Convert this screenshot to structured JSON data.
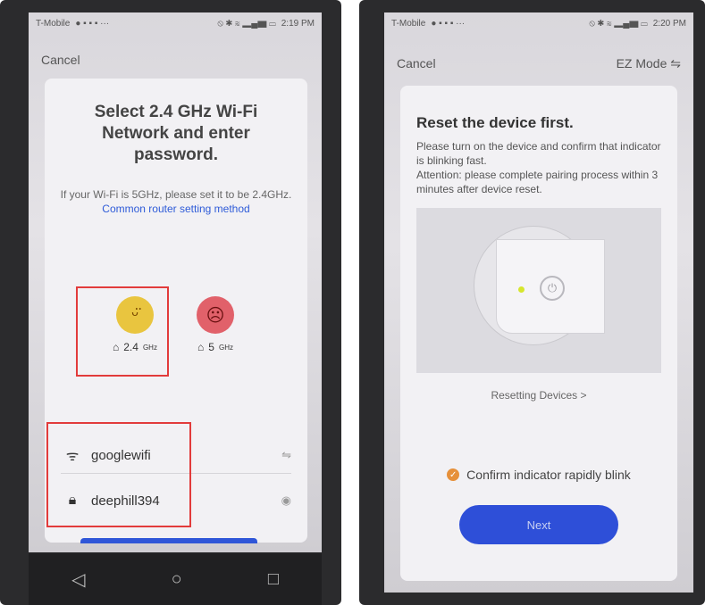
{
  "left": {
    "status": {
      "carrier": "T-Mobile",
      "time": "2:19 PM"
    },
    "cancel_label": "Cancel",
    "title": "Select 2.4 GHz Wi-Fi Network and enter password.",
    "description": "If your Wi-Fi is 5GHz, please set it to be 2.4GHz.",
    "link_text": "Common router setting method",
    "bands": [
      {
        "value": "2.4",
        "unit": "GHz"
      },
      {
        "value": "5",
        "unit": "GHz"
      }
    ],
    "wifi_name": "googlewifi",
    "wifi_password": "deephill394"
  },
  "right": {
    "status": {
      "carrier": "T-Mobile",
      "time": "2:20 PM"
    },
    "cancel_label": "Cancel",
    "mode_label": "EZ Mode",
    "title": "Reset the device first.",
    "desc1": "Please turn on the device and confirm that indicator is blinking fast.",
    "desc2": "Attention: please complete pairing process within 3 minutes after device reset.",
    "resetting_label": "Resetting Devices >",
    "confirm_label": "Confirm indicator rapidly blink",
    "next_label": "Next"
  },
  "colors": {
    "link": "#2e5bd8",
    "primary_button": "#2e4fd8",
    "highlight_box": "#e23b3b",
    "check": "#e6903a"
  }
}
